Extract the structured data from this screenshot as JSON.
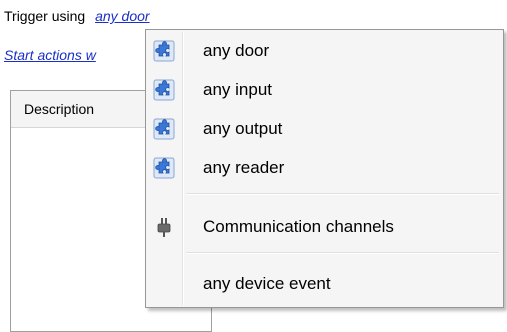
{
  "trigger": {
    "label": "Trigger using",
    "link": "any door"
  },
  "start_link": "Start actions w",
  "table": {
    "column_header": "Description"
  },
  "menu": {
    "items": [
      {
        "label": "any door",
        "icon": "puzzle-icon"
      },
      {
        "label": "any input",
        "icon": "puzzle-icon"
      },
      {
        "label": "any output",
        "icon": "puzzle-icon"
      },
      {
        "label": "any reader",
        "icon": "puzzle-icon"
      }
    ],
    "channels": {
      "label": "Communication channels",
      "icon": "plug-icon"
    },
    "device_event": {
      "label": "any device event"
    }
  },
  "colors": {
    "link": "#1a2fc7",
    "icon_blue": "#3a78d8",
    "menu_bg": "#f5f5f5"
  }
}
